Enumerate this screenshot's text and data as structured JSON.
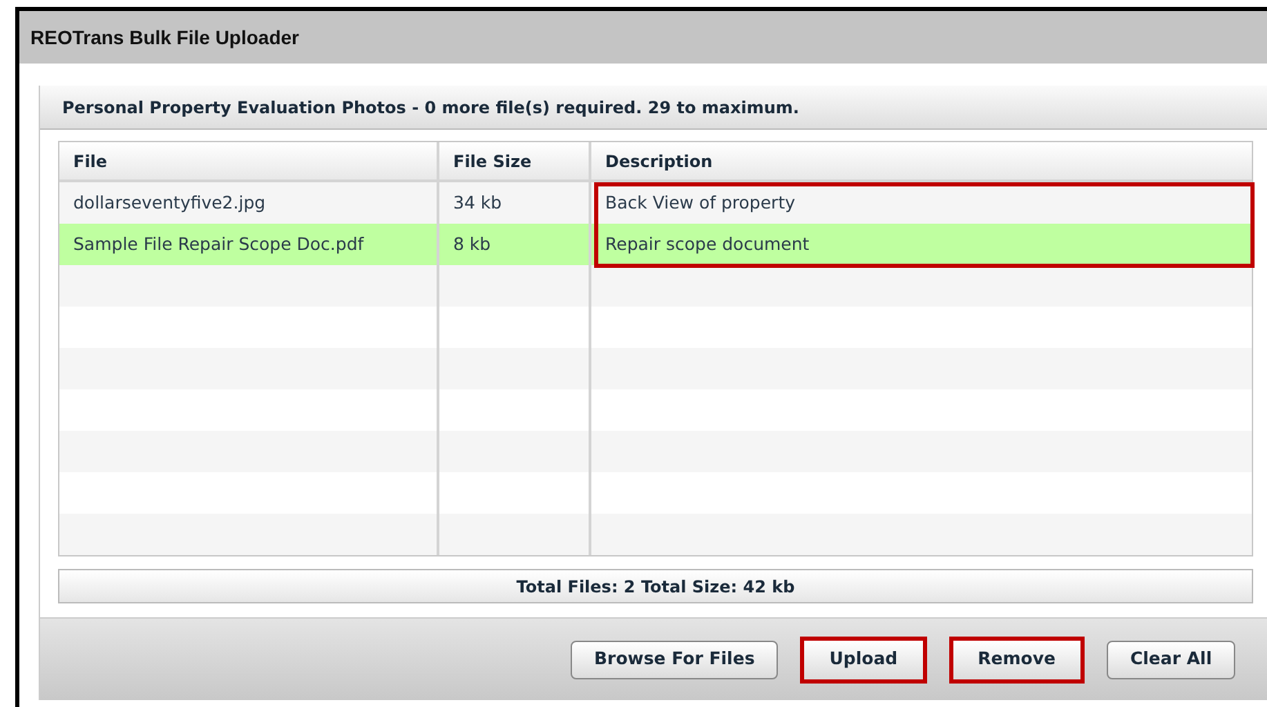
{
  "window": {
    "title": "REOTrans Bulk File Uploader"
  },
  "section": {
    "heading": "Personal Property Evaluation Photos - 0 more file(s) required. 29 to maximum."
  },
  "table": {
    "columns": [
      "File",
      "File Size",
      "Description"
    ],
    "description_highlighted": true,
    "rows": [
      {
        "file": "dollarseventyfive2.jpg",
        "size": "34 kb",
        "description": "Back View of property",
        "selected": false
      },
      {
        "file": "Sample File Repair Scope Doc.pdf",
        "size": "8 kb",
        "description": "Repair scope document",
        "selected": true
      }
    ]
  },
  "summary": "Total Files: 2 Total Size: 42 kb",
  "buttons": [
    {
      "label": "Browse For Files",
      "highlighted": false
    },
    {
      "label": "Upload",
      "highlighted": true
    },
    {
      "label": "Remove",
      "highlighted": true
    },
    {
      "label": "Clear All",
      "highlighted": false
    }
  ]
}
